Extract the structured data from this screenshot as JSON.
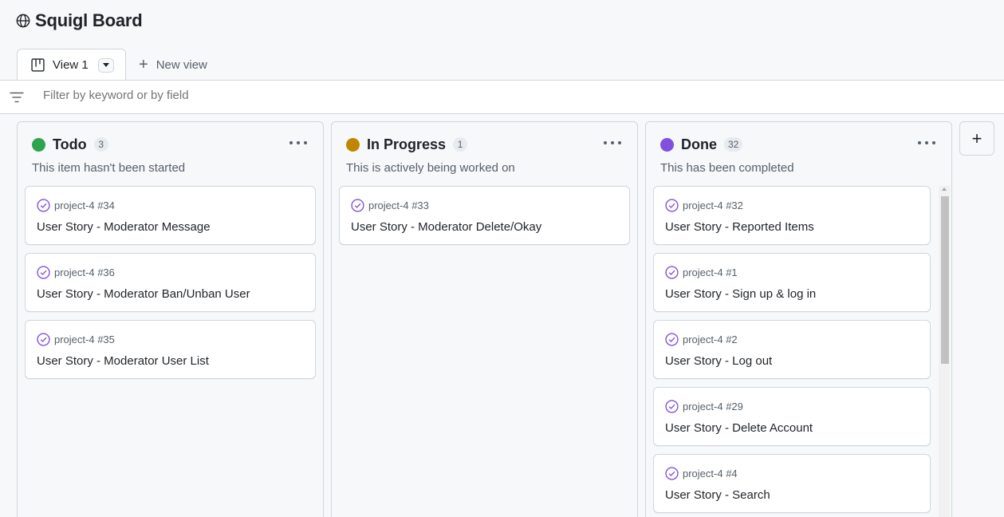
{
  "board": {
    "title": "Squigl Board",
    "title_icon": "globe-icon"
  },
  "tabs": {
    "active_label": "View 1",
    "new_view_label": "New view"
  },
  "filter": {
    "placeholder": "Filter by keyword or by field"
  },
  "colors": {
    "todo": "#2da44e",
    "in_progress": "#bf8700",
    "done": "#8250df",
    "accent_check": "#8250df"
  },
  "columns": [
    {
      "title": "Todo",
      "count": "3",
      "description": "This item hasn't been started",
      "cards": [
        {
          "ref": "project-4 #34",
          "title": "User Story - Moderator Message"
        },
        {
          "ref": "project-4 #36",
          "title": "User Story - Moderator Ban/Unban User"
        },
        {
          "ref": "project-4 #35",
          "title": "User Story - Moderator User List"
        }
      ]
    },
    {
      "title": "In Progress",
      "count": "1",
      "description": "This is actively being worked on",
      "cards": [
        {
          "ref": "project-4 #33",
          "title": "User Story - Moderator Delete/Okay"
        }
      ]
    },
    {
      "title": "Done",
      "count": "32",
      "description": "This has been completed",
      "cards": [
        {
          "ref": "project-4 #32",
          "title": "User Story - Reported Items"
        },
        {
          "ref": "project-4 #1",
          "title": "User Story - Sign up & log in"
        },
        {
          "ref": "project-4 #2",
          "title": "User Story - Log out"
        },
        {
          "ref": "project-4 #29",
          "title": "User Story - Delete Account"
        },
        {
          "ref": "project-4 #4",
          "title": "User Story - Search"
        }
      ]
    }
  ],
  "add_column_label": "+"
}
